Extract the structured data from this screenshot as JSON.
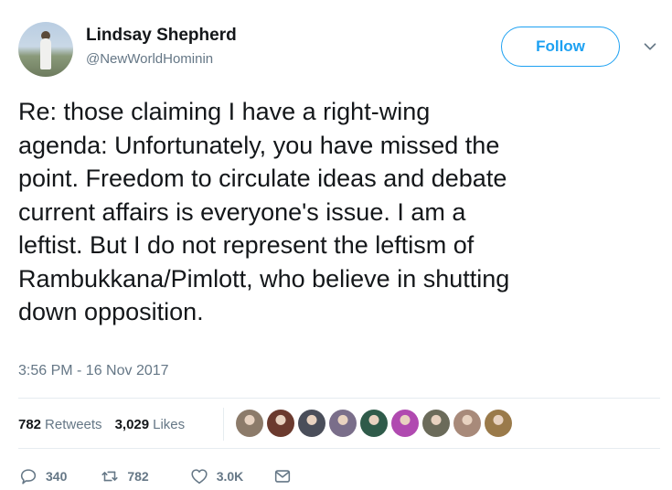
{
  "author": {
    "name": "Lindsay Shepherd",
    "handle": "@NewWorldHominin"
  },
  "follow_label": "Follow",
  "tweet": {
    "text": "Re: those claiming I have a right-wing\nagenda: Unfortunately, you have missed the\npoint. Freedom to circulate ideas and debate\ncurrent affairs is everyone's issue. I am a\nleftist. But I do not represent the leftism of\nRambukkana/Pimlott, who believe in shutting\ndown opposition.",
    "timestamp": "3:56 PM - 16 Nov 2017"
  },
  "stats": {
    "retweets_count": "782",
    "retweets_label": "Retweets",
    "likes_count": "3,029",
    "likes_label": "Likes"
  },
  "liker_avatars": [
    {
      "color": "#8c7b6a"
    },
    {
      "color": "#6b3a2e"
    },
    {
      "color": "#4a4e5a"
    },
    {
      "color": "#7a6e8a"
    },
    {
      "color": "#2f5b4a"
    },
    {
      "color": "#b04ab0"
    },
    {
      "color": "#6b6b5a"
    },
    {
      "color": "#a88a7a"
    },
    {
      "color": "#9a7a4a"
    }
  ],
  "actions": {
    "replies": "340",
    "retweets": "782",
    "likes": "3.0K"
  },
  "colors": {
    "accent": "#1da1f2",
    "muted": "#657786",
    "text": "#14171a"
  }
}
